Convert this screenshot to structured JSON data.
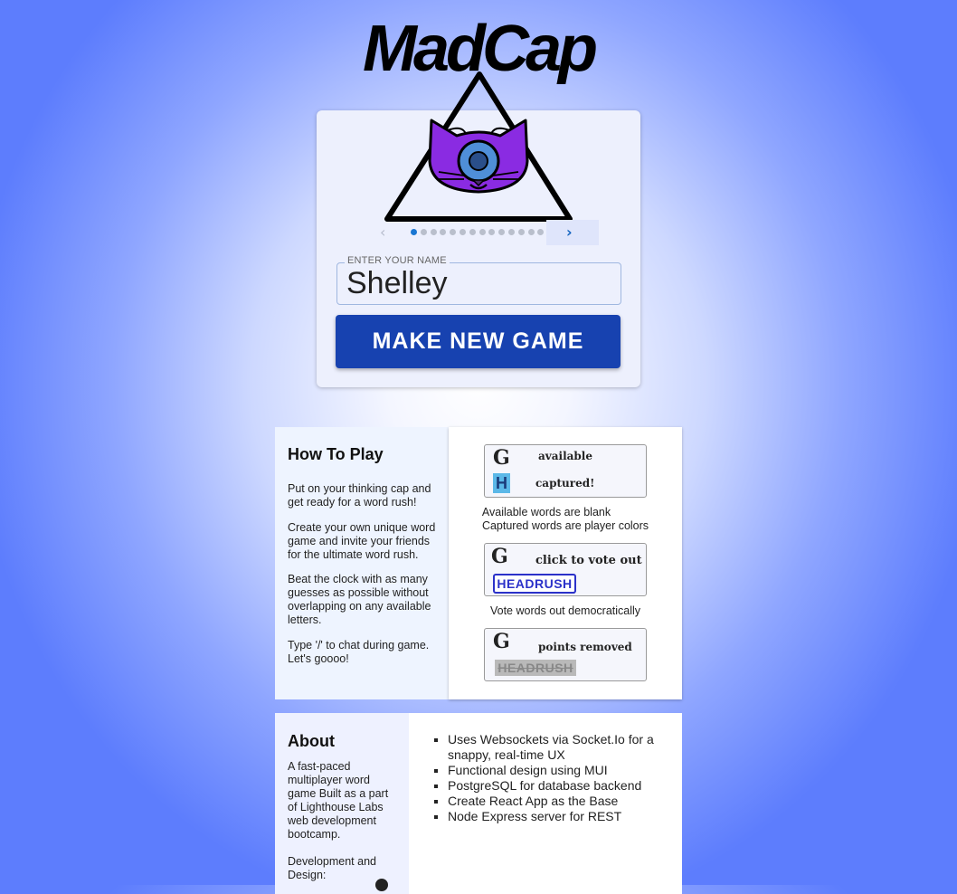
{
  "app": {
    "logo_text": "MadCap"
  },
  "avatar": {
    "icon": "cyclops-cat-triangle-icon",
    "colors": {
      "fur": "#8a2be2",
      "eye": "#4f8fd8",
      "outline": "#000000"
    }
  },
  "carousel": {
    "prev_icon": "chevron-left-icon",
    "next_icon": "chevron-right-icon",
    "prev_glyph": "‹",
    "next_glyph": "›",
    "slide_count": 14,
    "active_index": 0
  },
  "form": {
    "name_label": "ENTER YOUR NAME",
    "name_value": "Shelley",
    "submit_label": "MAKE NEW GAME",
    "accent": "#1742b0"
  },
  "how_to_play": {
    "title": "How To Play",
    "paragraphs": [
      "Put on your thinking cap and get ready for a word rush!",
      "Create your own unique word game and invite your friends for the ultimate word rush.",
      "Beat the clock with as many guesses as possible without overlapping on any available letters.",
      "Type '/' to chat during game. Let's goooo!"
    ],
    "demo1": {
      "available_text": "available",
      "captured_text": "captured!",
      "tile_letter": "H",
      "caption_line1": "Available words are blank",
      "caption_line2": "Captured words are player colors"
    },
    "demo2": {
      "vote_text": "click to vote out",
      "word": "HEADRUSH",
      "caption": "Vote words out democratically"
    },
    "demo3": {
      "points_text": "points removed",
      "word": "HEADRUSH"
    }
  },
  "about": {
    "title": "About",
    "description": "A fast-paced multiplayer word game Built as a part of Lighthouse Labs web development bootcamp.",
    "dev_label": "Development and Design:",
    "features": [
      "Uses Websockets via Socket.Io for a snappy, real-time UX",
      "Functional design using MUI",
      "PostgreSQL for database backend",
      "Create React App as the Base",
      "Node Express server for REST"
    ]
  }
}
